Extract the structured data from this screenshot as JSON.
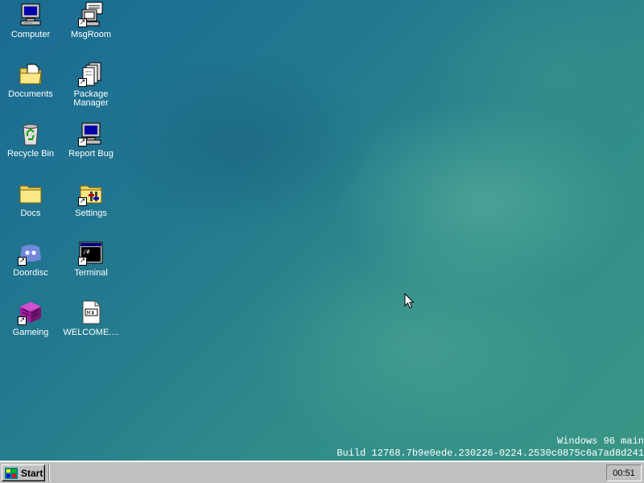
{
  "desktop": {
    "icons": [
      {
        "label": "Computer",
        "icon": "computer-icon",
        "shortcut": false
      },
      {
        "label": "MsgRoom",
        "icon": "msgroom-icon",
        "shortcut": true
      },
      {
        "label": "Documents",
        "icon": "documents-folder-icon",
        "shortcut": false
      },
      {
        "label": "Package Manager",
        "icon": "package-manager-icon",
        "shortcut": true
      },
      {
        "label": "Recycle Bin",
        "icon": "recycle-bin-icon",
        "shortcut": false
      },
      {
        "label": "Report Bug",
        "icon": "report-bug-icon",
        "shortcut": true
      },
      {
        "label": "Docs",
        "icon": "folder-icon",
        "shortcut": false
      },
      {
        "label": "Settings",
        "icon": "settings-icon",
        "shortcut": true
      },
      {
        "label": "Doordisc",
        "icon": "doordisc-icon",
        "shortcut": true
      },
      {
        "label": "Terminal",
        "icon": "terminal-icon",
        "shortcut": true
      },
      {
        "label": "Gameing",
        "icon": "gameing-icon",
        "shortcut": true
      },
      {
        "label": "WELCOME....",
        "icon": "markdown-file-icon",
        "shortcut": false
      }
    ],
    "build_line1": "Windows 96 main",
    "build_line2": "Build 12768.7b9e0ede.230226-0224.2530c0875c6a7ad8d241"
  },
  "taskbar": {
    "start_label": "Start",
    "clock": "00:51"
  },
  "colors": {
    "desktop_top": "#1b6b93",
    "desktop_bottom": "#3a9686",
    "taskbar": "#c0c0c0"
  }
}
